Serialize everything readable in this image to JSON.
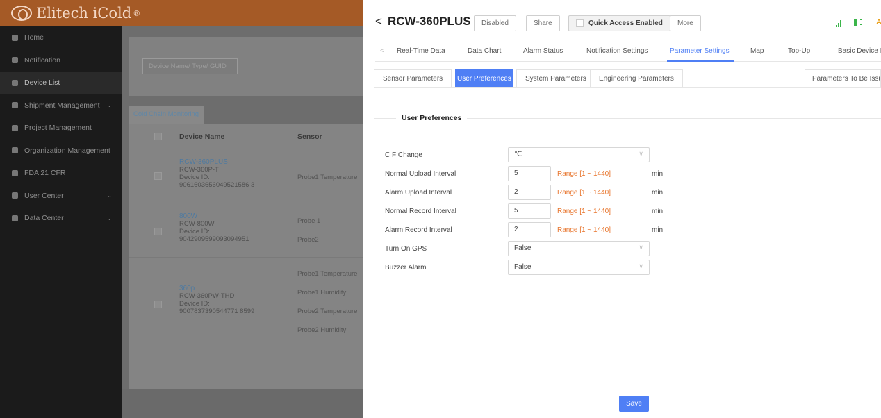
{
  "app": {
    "brand": "Elitech iCold",
    "brand_mark": "®"
  },
  "sidebar": {
    "items": [
      {
        "label": "Home",
        "icon": "home-icon"
      },
      {
        "label": "Notification",
        "icon": "notification-icon"
      },
      {
        "label": "Device List",
        "icon": "device-list-icon"
      },
      {
        "label": "Shipment Management",
        "icon": "shipment-icon",
        "chevron": "⌄"
      },
      {
        "label": "Project Management",
        "icon": "project-icon"
      },
      {
        "label": "Organization Management",
        "icon": "organization-icon"
      },
      {
        "label": "FDA 21 CFR",
        "icon": "shield-icon"
      },
      {
        "label": "User Center",
        "icon": "user-icon",
        "chevron": "⌄"
      },
      {
        "label": "Data Center",
        "icon": "data-center-icon",
        "chevron": "⌄"
      }
    ]
  },
  "device_list": {
    "search_placeholder": "Device Name/ Type/ GUID",
    "tab": "Cold Chain Monitoring",
    "columns": [
      "Device Name",
      "Sensor"
    ],
    "rows": [
      {
        "name": "RCW-360PLUS",
        "model": "RCW-360P-T",
        "id_label": "Device ID:",
        "id": "9061603656049521586 3",
        "sensors": [
          "Probe1 Temperature"
        ]
      },
      {
        "name": "800W",
        "model": "RCW-800W",
        "id_label": "Device ID:",
        "id": "9042909599093094951",
        "sensors": [
          "Probe 1",
          "Probe2"
        ]
      },
      {
        "name": "360p",
        "model": "RCW-360PW-THD",
        "id_label": "Device ID:",
        "id": "9007837390544771 8599",
        "sensors": [
          "Probe1 Temperature",
          "Probe1 Humidity",
          "Probe2 Temperature",
          "Probe2 Humidity"
        ]
      }
    ]
  },
  "panel": {
    "back": "<",
    "title": "RCW-360PLUS",
    "buttons": {
      "disabled": "Disabled",
      "share": "Share",
      "quick_access": "Quick Access Enabled",
      "more": "More"
    },
    "status_letter": "A",
    "tabs": [
      "Real-Time Data",
      "Data Chart",
      "Alarm Status",
      "Notification Settings",
      "Parameter Settings",
      "Map",
      "Top-Up",
      "Basic Device Inf"
    ],
    "active_tab": "Parameter Settings",
    "sub_tabs": [
      "Sensor Parameters",
      "User Preferences",
      "System Parameters",
      "Engineering Parameters"
    ],
    "active_sub_tab": "User Preferences",
    "issue_button": "Parameters To Be Issue",
    "section_title": "User Preferences",
    "fields": {
      "cf_change": {
        "label": "C F Change",
        "value": "℃"
      },
      "normal_upload": {
        "label": "Normal Upload Interval",
        "value": "5",
        "range": "Range [1 ~ 1440]",
        "unit": "min"
      },
      "alarm_upload": {
        "label": "Alarm Upload Interval",
        "value": "2",
        "range": "Range [1 ~ 1440]",
        "unit": "min"
      },
      "normal_record": {
        "label": "Normal Record Interval",
        "value": "5",
        "range": "Range [1 ~ 1440]",
        "unit": "min"
      },
      "alarm_record": {
        "label": "Alarm Record Interval",
        "value": "2",
        "range": "Range [1 ~ 1440]",
        "unit": "min"
      },
      "gps": {
        "label": "Turn On GPS",
        "value": "False"
      },
      "buzzer": {
        "label": "Buzzer Alarm",
        "value": "False"
      }
    },
    "save": "Save"
  },
  "colors": {
    "accent": "#4f7ff5",
    "range": "#e8762e",
    "signal": "#3bb54a",
    "topbar": "#a55a26"
  }
}
